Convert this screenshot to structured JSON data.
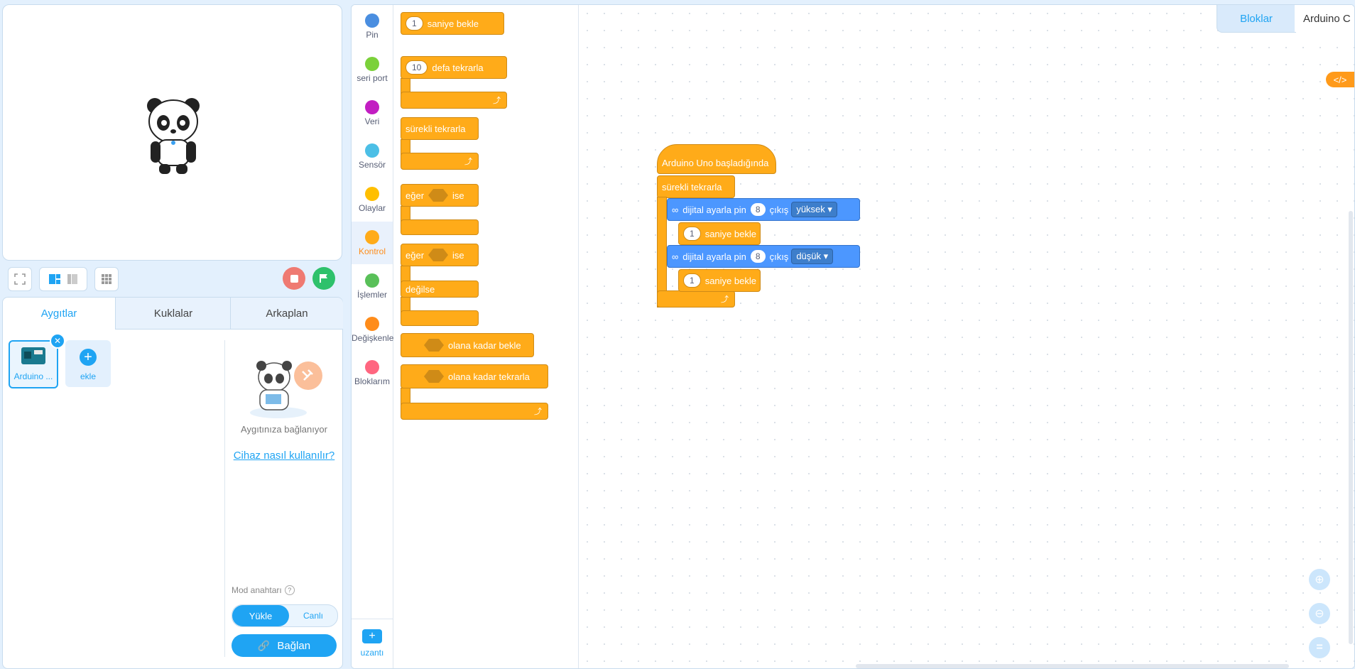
{
  "stage": {
    "fullscreen_icon": "fullscreen-icon"
  },
  "stage_toolbar": {
    "layout_icons": [
      "layout-large-stage-icon",
      "layout-small-stage-icon",
      "grid-icon"
    ],
    "stop_color": "#ef7a72",
    "go_color": "#2ec16b"
  },
  "device_panel": {
    "tabs": [
      "Aygıtlar",
      "Kuklalar",
      "Arkaplan"
    ],
    "device_label": "Arduino ...",
    "add_label": "ekle",
    "connecting_text": "Aygıtınıza bağlanıyor",
    "help_link": "Cihaz nasıl kullanılır?",
    "mode_label": "Mod anahtarı",
    "mode_options": [
      "Yükle",
      "Canlı"
    ],
    "connect_button": "Bağlan"
  },
  "categories": [
    {
      "label": "Pin",
      "color": "#4a8ee0"
    },
    {
      "label": "seri port",
      "color": "#7bd13a"
    },
    {
      "label": "Veri",
      "color": "#c21ec2"
    },
    {
      "label": "Sensör",
      "color": "#4cbfe6"
    },
    {
      "label": "Olaylar",
      "color": "#ffbf00"
    },
    {
      "label": "Kontrol",
      "color": "#ffab19"
    },
    {
      "label": "İşlemler",
      "color": "#59c059"
    },
    {
      "label": "Değişkenle",
      "color": "#ff8c1a"
    },
    {
      "label": "Bloklarım",
      "color": "#ff6680"
    }
  ],
  "extension_label": "uzantı",
  "palette": {
    "wait_value": "1",
    "wait_label": "saniye bekle",
    "repeat_value": "10",
    "repeat_label": "defa tekrarla",
    "forever_label": "sürekli tekrarla",
    "if_label": "eğer",
    "then_label": "ise",
    "else_label": "değilse",
    "wait_until_label": "olana kadar bekle",
    "repeat_until_label": "olana kadar tekrarla"
  },
  "editor_tabs": [
    "Bloklar",
    "Arduino C"
  ],
  "script": {
    "hat": "Arduino Uno başladığında",
    "forever": "sürekli tekrarla",
    "set_pin_label": "dijital ayarla pin",
    "pin_value": "8",
    "output_label": "çıkış",
    "high_value": "yüksek",
    "low_value": "düşük",
    "wait_value": "1",
    "wait_label": "saniye bekle"
  }
}
